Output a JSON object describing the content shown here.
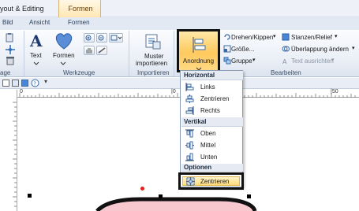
{
  "titlebar": {
    "title": "yout & Editing",
    "context_tab": "Formen"
  },
  "tabs": [
    "Bild",
    "Ansicht",
    "Formen"
  ],
  "ribbon": {
    "partial_group_label": "age",
    "werkzeuge": {
      "label": "Werkzeuge",
      "text_button": "Text",
      "formen_button": "Formen"
    },
    "importieren": {
      "label": "Importieren",
      "muster_button_line1": "Muster",
      "muster_button_line2": "importieren"
    },
    "anordnung_button": "Anordnung",
    "bearbeiten": {
      "label": "Bearbeiten",
      "drehen": "Drehen/Kippen",
      "groesse": "Größe...",
      "gruppe": "Gruppe",
      "stanzen": "Stanzen/Relief",
      "ueberlappung": "Überlappung ändern",
      "text_ausrichten": "Text ausrichten"
    }
  },
  "ruler": {
    "ticks": [
      "0",
      "|0",
      "|50"
    ]
  },
  "menu": {
    "horizontal_header": "Horizontal",
    "horizontal_items": [
      "Links",
      "Zentrieren",
      "Rechts"
    ],
    "vertikal_header": "Vertikal",
    "vertikal_items": [
      "Oben",
      "Mittel",
      "Unten"
    ],
    "optionen_header": "Optionen",
    "optionen_items": [
      "Zentrieren"
    ]
  },
  "colors": {
    "highlight": "#ffc95e",
    "selection_handle": "#000000",
    "rotation_handle": "#e0201a",
    "shape_fill": "#f7c9cf"
  }
}
